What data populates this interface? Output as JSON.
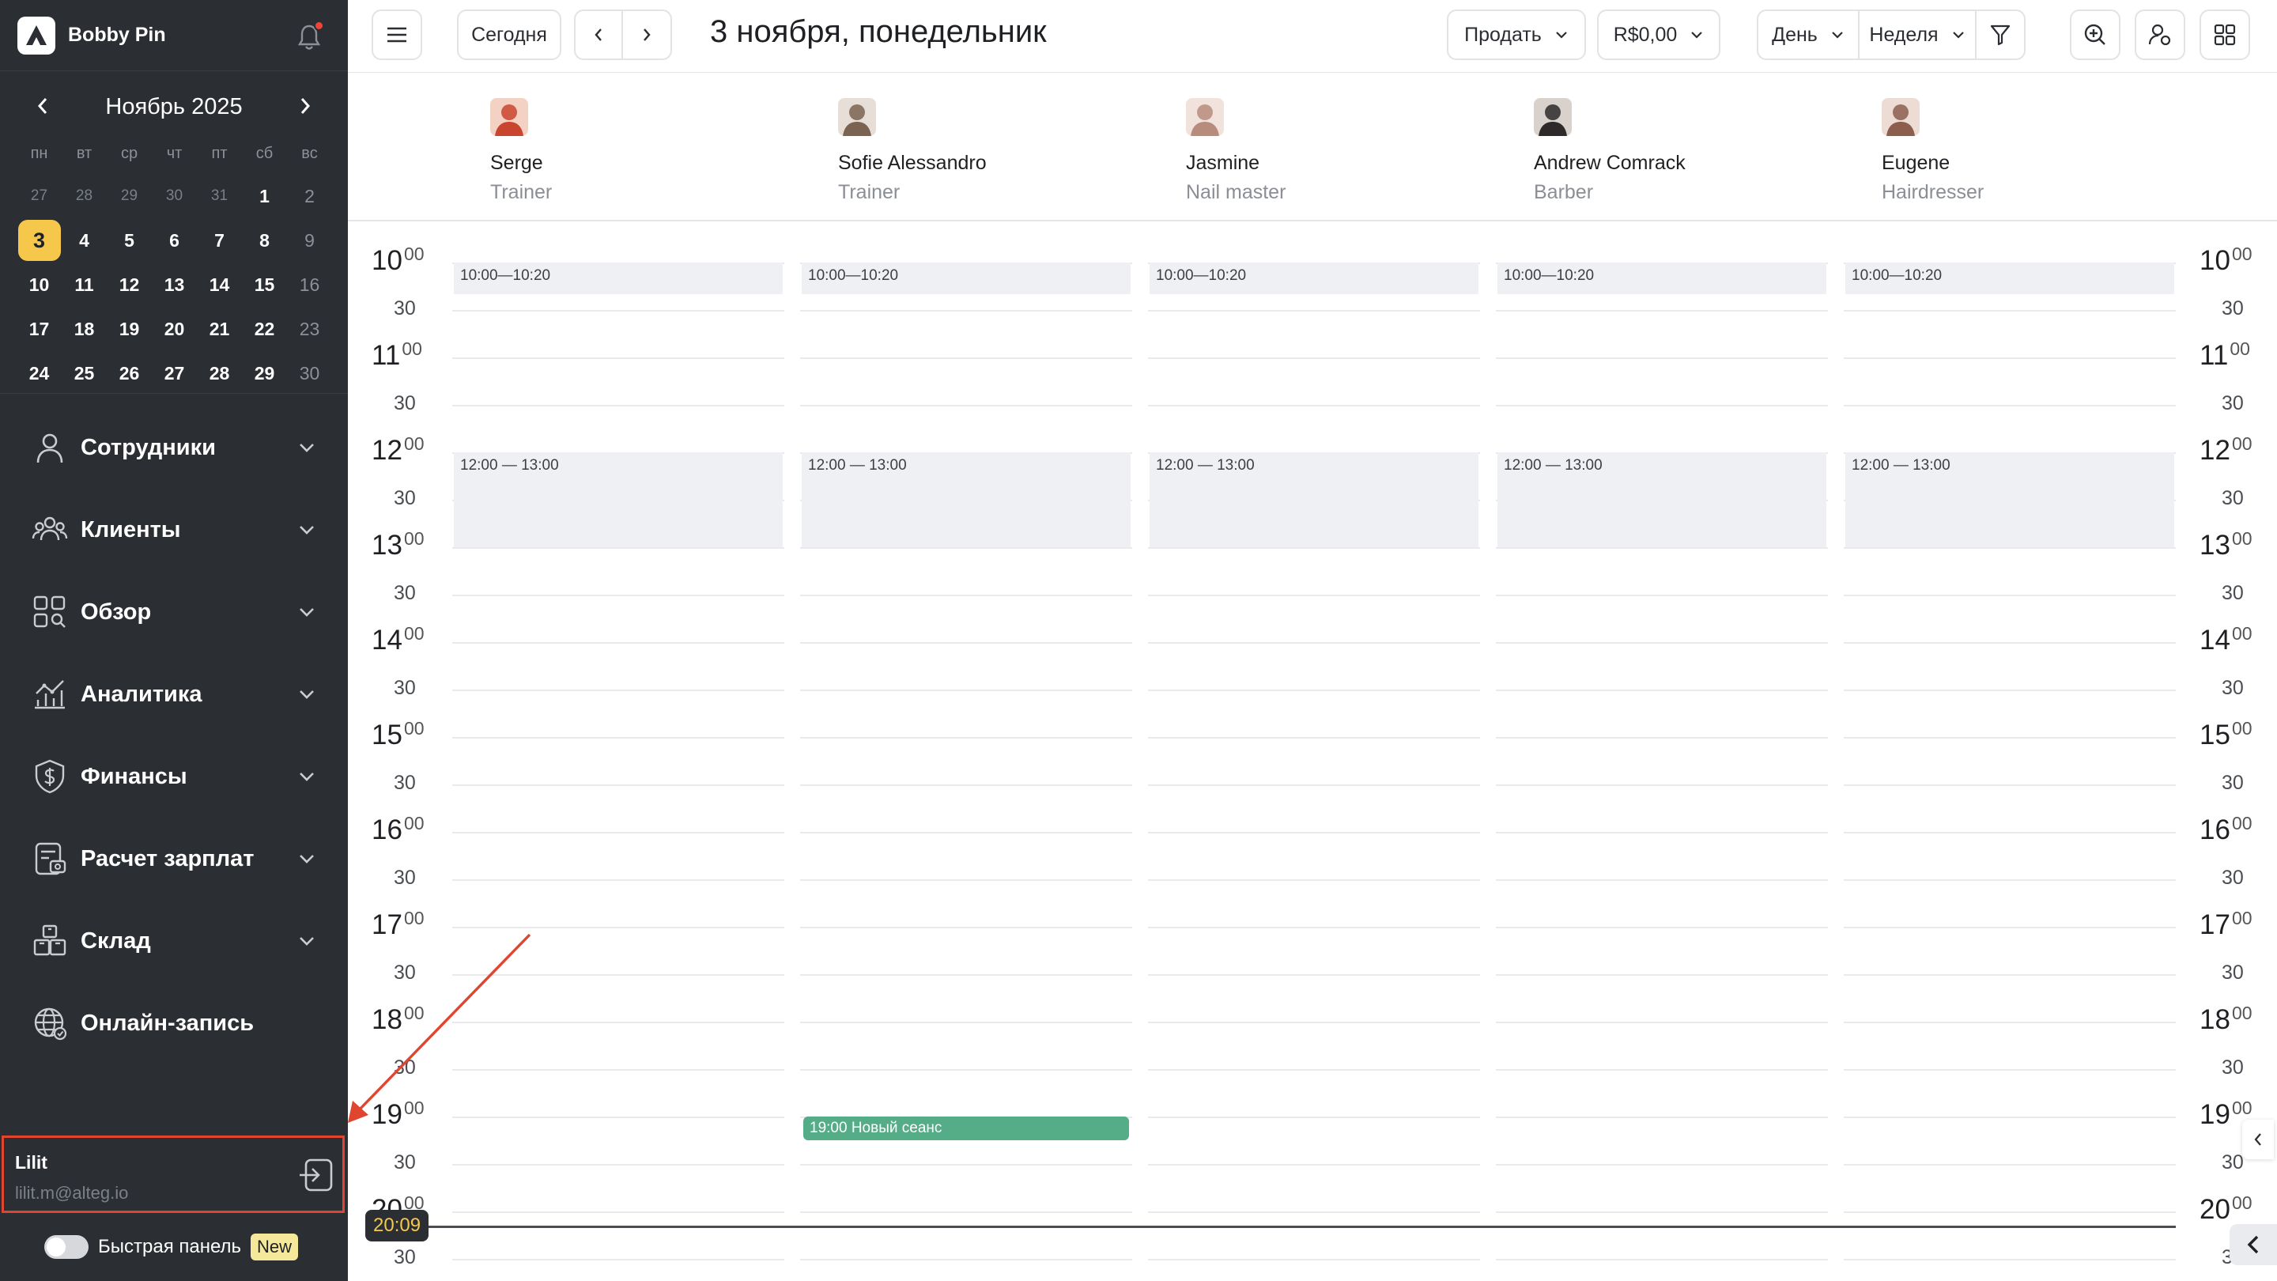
{
  "brand": {
    "name": "Bobby Pin"
  },
  "mini_calendar": {
    "title": "Ноябрь 2025",
    "weekdays": [
      "пн",
      "вт",
      "ср",
      "чт",
      "пт",
      "сб",
      "вс"
    ],
    "weeks": [
      [
        "27",
        "28",
        "29",
        "30",
        "31",
        "1",
        "2"
      ],
      [
        "3",
        "4",
        "5",
        "6",
        "7",
        "8",
        "9"
      ],
      [
        "10",
        "11",
        "12",
        "13",
        "14",
        "15",
        "16"
      ],
      [
        "17",
        "18",
        "19",
        "20",
        "21",
        "22",
        "23"
      ],
      [
        "24",
        "25",
        "26",
        "27",
        "28",
        "29",
        "30"
      ]
    ],
    "selected_day": "3"
  },
  "nav": [
    {
      "label": "Сотрудники",
      "icon": "user-icon",
      "expandable": true
    },
    {
      "label": "Клиенты",
      "icon": "users-group-icon",
      "expandable": true
    },
    {
      "label": "Обзор",
      "icon": "grid-search-icon",
      "expandable": true
    },
    {
      "label": "Аналитика",
      "icon": "analytics-icon",
      "expandable": true
    },
    {
      "label": "Финансы",
      "icon": "dollar-shield-icon",
      "expandable": true
    },
    {
      "label": "Расчет зарплат",
      "icon": "payroll-icon",
      "expandable": true
    },
    {
      "label": "Склад",
      "icon": "boxes-icon",
      "expandable": true
    },
    {
      "label": "Онлайн-запись",
      "icon": "globe-icon",
      "expandable": false
    }
  ],
  "user": {
    "name": "Lilit",
    "email": "lilit.m@alteg.io"
  },
  "quick_panel": {
    "label": "Быстрая панель",
    "badge": "New",
    "enabled": false
  },
  "toolbar": {
    "today_label": "Сегодня",
    "date_title": "3 ноября, понедельник",
    "sell_label": "Продать",
    "balance_label": "R$0,00",
    "view_day_label": "День",
    "view_week_label": "Неделя"
  },
  "staff": [
    {
      "name": "Serge",
      "role": "Trainer"
    },
    {
      "name": "Sofie Alessandro",
      "role": "Trainer"
    },
    {
      "name": "Jasmine",
      "role": "Nail master"
    },
    {
      "name": "Andrew Comrack",
      "role": "Barber"
    },
    {
      "name": "Eugene",
      "role": "Hairdresser"
    }
  ],
  "time_slots": [
    {
      "hour": "10",
      "min": "00"
    },
    {
      "hour": "11",
      "min": "00"
    },
    {
      "hour": "12",
      "min": "00"
    },
    {
      "hour": "13",
      "min": "00"
    },
    {
      "hour": "14",
      "min": "00"
    },
    {
      "hour": "15",
      "min": "00"
    },
    {
      "hour": "16",
      "min": "00"
    },
    {
      "hour": "17",
      "min": "00"
    },
    {
      "hour": "18",
      "min": "00"
    },
    {
      "hour": "19",
      "min": "00"
    },
    {
      "hour": "20",
      "min": "00"
    }
  ],
  "half_hour_label": "30",
  "blocked_slots": [
    {
      "label": "10:00—10:20",
      "start": "10:00",
      "end": "10:20"
    },
    {
      "label": "12:00 — 13:00",
      "start": "12:00",
      "end": "13:00"
    }
  ],
  "events": [
    {
      "staff_index": 1,
      "label": "19:00 Новый сеанс",
      "start": "19:00",
      "end": "19:15",
      "color": "#55ad87"
    }
  ],
  "current_time": "20:09",
  "colors": {
    "sidebar": "#2b2e33",
    "accent": "#f5c84c",
    "event": "#55ad87",
    "annotation": "#e0452f",
    "blocked": "#eff0f3"
  }
}
